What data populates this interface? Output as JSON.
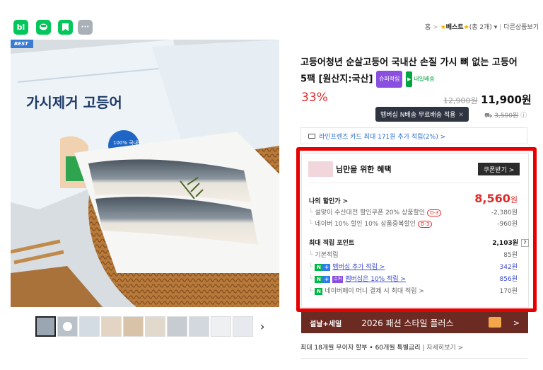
{
  "share": [
    {
      "label": "bl",
      "icon": "blog-icon",
      "color": "#03c75a"
    },
    {
      "label": "",
      "icon": "talk-icon",
      "color": "#03c75a"
    },
    {
      "label": "",
      "icon": "bookmark-icon",
      "color": "#03c75a"
    },
    {
      "label": "···",
      "icon": "more-icon",
      "color": "#aab0b8"
    }
  ],
  "breadcrumb": {
    "home": "홈",
    "best": "베스트",
    "count": "(총 2개)",
    "other": "다른상품보기"
  },
  "image": {
    "best_tag": "BEST",
    "package_text_1": "가시제거 고등어",
    "package_text_2": "100% 국내산"
  },
  "product": {
    "title": "고등어청년 순살고등어 국내산 손질 가시 뼈 없는 고등어 5팩 [원산지:국산]",
    "badge_super": "슈퍼적립",
    "badge_today": "내일배송",
    "discount": "33%",
    "original_price": "12,900원",
    "sale_price": "11,900원"
  },
  "shipping": {
    "tooltip": "멤버십 N배송 무료배송 적용",
    "fee": "3,500원"
  },
  "card_promo": "라인프렌즈 카드 최대 171원 추가 적립(2%) >",
  "benefits": {
    "title_suffix": "님만을 위한 혜택",
    "coupon_button": "쿠폰받기 >",
    "my_price_label": "나의 할인가 >",
    "my_price_value": "8,560",
    "my_price_unit": "원",
    "discount_1": {
      "label": "설맞이 수산대전 할인쿠폰 20% 상품할인",
      "tag": "D-3",
      "value": "-2,380원"
    },
    "discount_2": {
      "label": "네이버 10% 할인 10% 상품중복할인",
      "tag": "D-3",
      "value": "-960원"
    },
    "points_label": "최대 적립 포인트",
    "points_value": "2,103원",
    "points_rows": [
      {
        "label": "기본적립",
        "value": "85원"
      },
      {
        "label": "멤버십 추가 적립 >",
        "value": "342원"
      },
      {
        "label": "멤버십은 10% 적립 >",
        "value": "856원"
      },
      {
        "label": "네이버페이 머니 결제 시 최대 적립 >",
        "value": "170원"
      }
    ]
  },
  "banner": {
    "tag": "설날+세일",
    "text": "2026 패션 스타일 플러스",
    "arrow": ">"
  },
  "installment": {
    "text": "최대 18개월 무이자 할부 • 60개월 특별금리",
    "more": "자세히보기 >"
  }
}
